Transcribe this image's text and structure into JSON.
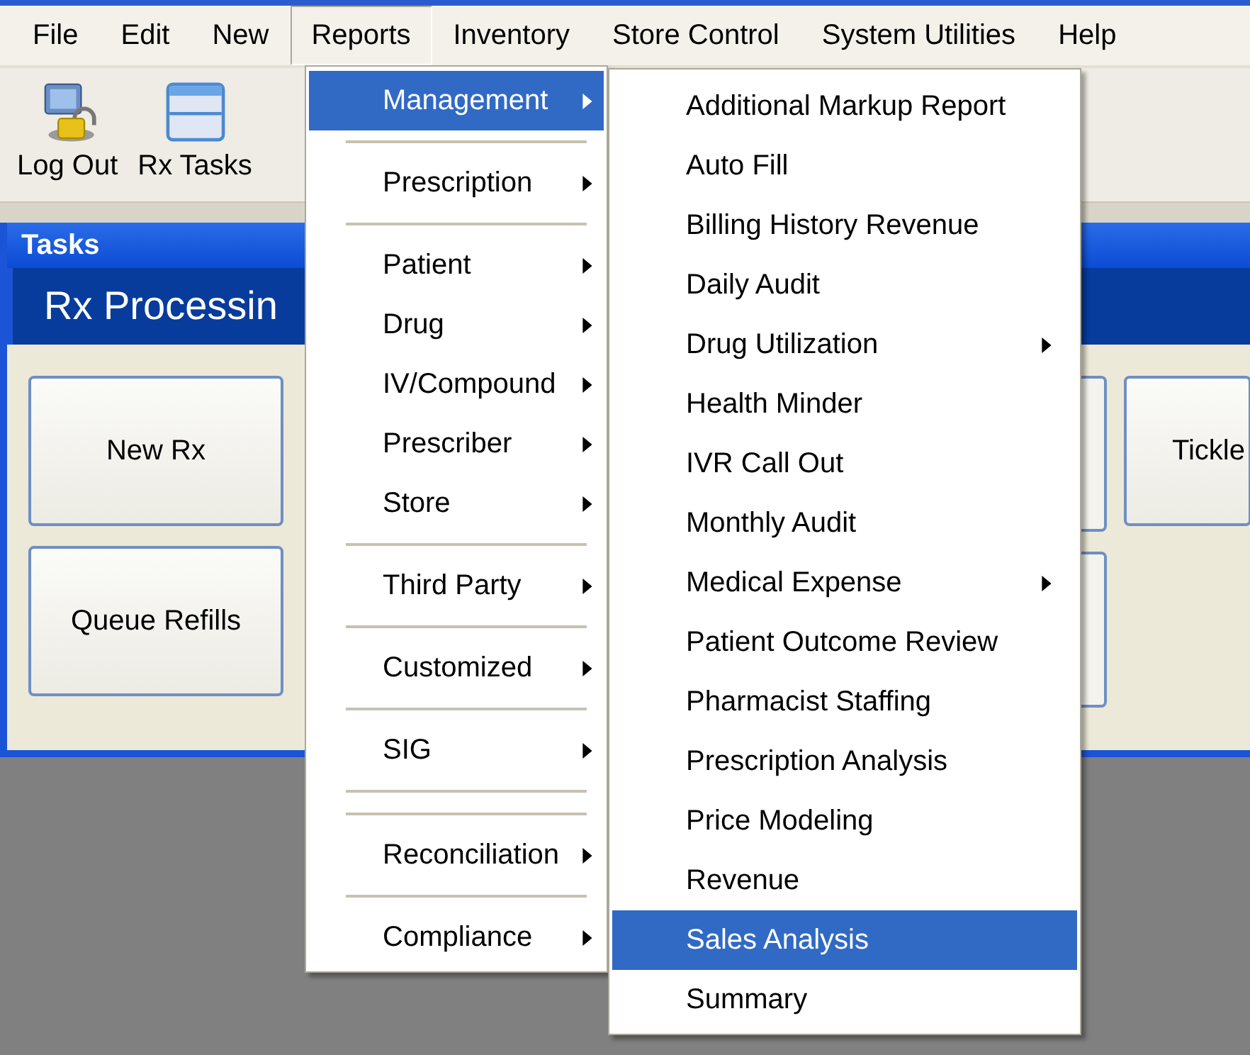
{
  "menu_bar": [
    {
      "label": "File",
      "selected": false
    },
    {
      "label": "Edit",
      "selected": false
    },
    {
      "label": "New",
      "selected": false
    },
    {
      "label": "Reports",
      "selected": true
    },
    {
      "label": "Inventory",
      "selected": false
    },
    {
      "label": "Store Control",
      "selected": false
    },
    {
      "label": "System Utilities",
      "selected": false
    },
    {
      "label": "Help",
      "selected": false
    }
  ],
  "toolbar": [
    {
      "kind": "logout",
      "label": "Log Out"
    },
    {
      "kind": "tasks",
      "label": "Rx Tasks"
    }
  ],
  "tasks_panel": {
    "title": "Tasks",
    "header": "Rx Processin",
    "buttons": [
      {
        "label": "New Rx"
      },
      {
        "label": "Queue Refills"
      }
    ],
    "right_buttons": [
      {
        "label": "Tickle"
      }
    ]
  },
  "reports_menu": [
    {
      "kind": "item",
      "label": "Management",
      "submenu": true,
      "selected": true
    },
    {
      "kind": "separator"
    },
    {
      "kind": "item",
      "label": "Prescription",
      "submenu": true,
      "selected": false
    },
    {
      "kind": "separator"
    },
    {
      "kind": "item",
      "label": "Patient",
      "submenu": true,
      "selected": false
    },
    {
      "kind": "item",
      "label": "Drug",
      "submenu": true,
      "selected": false
    },
    {
      "kind": "item",
      "label": "IV/Compound",
      "submenu": true,
      "selected": false
    },
    {
      "kind": "item",
      "label": "Prescriber",
      "submenu": true,
      "selected": false
    },
    {
      "kind": "item",
      "label": "Store",
      "submenu": true,
      "selected": false
    },
    {
      "kind": "separator"
    },
    {
      "kind": "item",
      "label": "Third Party",
      "submenu": true,
      "selected": false
    },
    {
      "kind": "separator"
    },
    {
      "kind": "item",
      "label": "Customized",
      "submenu": true,
      "selected": false
    },
    {
      "kind": "separator"
    },
    {
      "kind": "item",
      "label": "SIG",
      "submenu": true,
      "selected": false
    },
    {
      "kind": "separator"
    },
    {
      "kind": "separator"
    },
    {
      "kind": "item",
      "label": "Reconciliation",
      "submenu": true,
      "selected": false
    },
    {
      "kind": "separator"
    },
    {
      "kind": "item",
      "label": "Compliance",
      "submenu": true,
      "selected": false
    }
  ],
  "management_menu": [
    {
      "kind": "item",
      "label": "Additional Markup Report",
      "submenu": false,
      "selected": false
    },
    {
      "kind": "item",
      "label": "Auto Fill",
      "submenu": false,
      "selected": false
    },
    {
      "kind": "item",
      "label": "Billing History Revenue",
      "submenu": false,
      "selected": false
    },
    {
      "kind": "item",
      "label": "Daily Audit",
      "submenu": false,
      "selected": false
    },
    {
      "kind": "item",
      "label": "Drug Utilization",
      "submenu": true,
      "selected": false
    },
    {
      "kind": "item",
      "label": "Health Minder",
      "submenu": false,
      "selected": false
    },
    {
      "kind": "item",
      "label": "IVR Call Out",
      "submenu": false,
      "selected": false
    },
    {
      "kind": "item",
      "label": "Monthly Audit",
      "submenu": false,
      "selected": false
    },
    {
      "kind": "item",
      "label": "Medical Expense",
      "submenu": true,
      "selected": false
    },
    {
      "kind": "item",
      "label": "Patient Outcome Review",
      "submenu": false,
      "selected": false
    },
    {
      "kind": "item",
      "label": "Pharmacist Staffing",
      "submenu": false,
      "selected": false
    },
    {
      "kind": "item",
      "label": "Prescription Analysis",
      "submenu": false,
      "selected": false
    },
    {
      "kind": "item",
      "label": "Price Modeling",
      "submenu": false,
      "selected": false
    },
    {
      "kind": "item",
      "label": "Revenue",
      "submenu": false,
      "selected": false
    },
    {
      "kind": "item",
      "label": "Sales Analysis",
      "submenu": false,
      "selected": true
    },
    {
      "kind": "item",
      "label": "Summary",
      "submenu": false,
      "selected": false
    }
  ]
}
